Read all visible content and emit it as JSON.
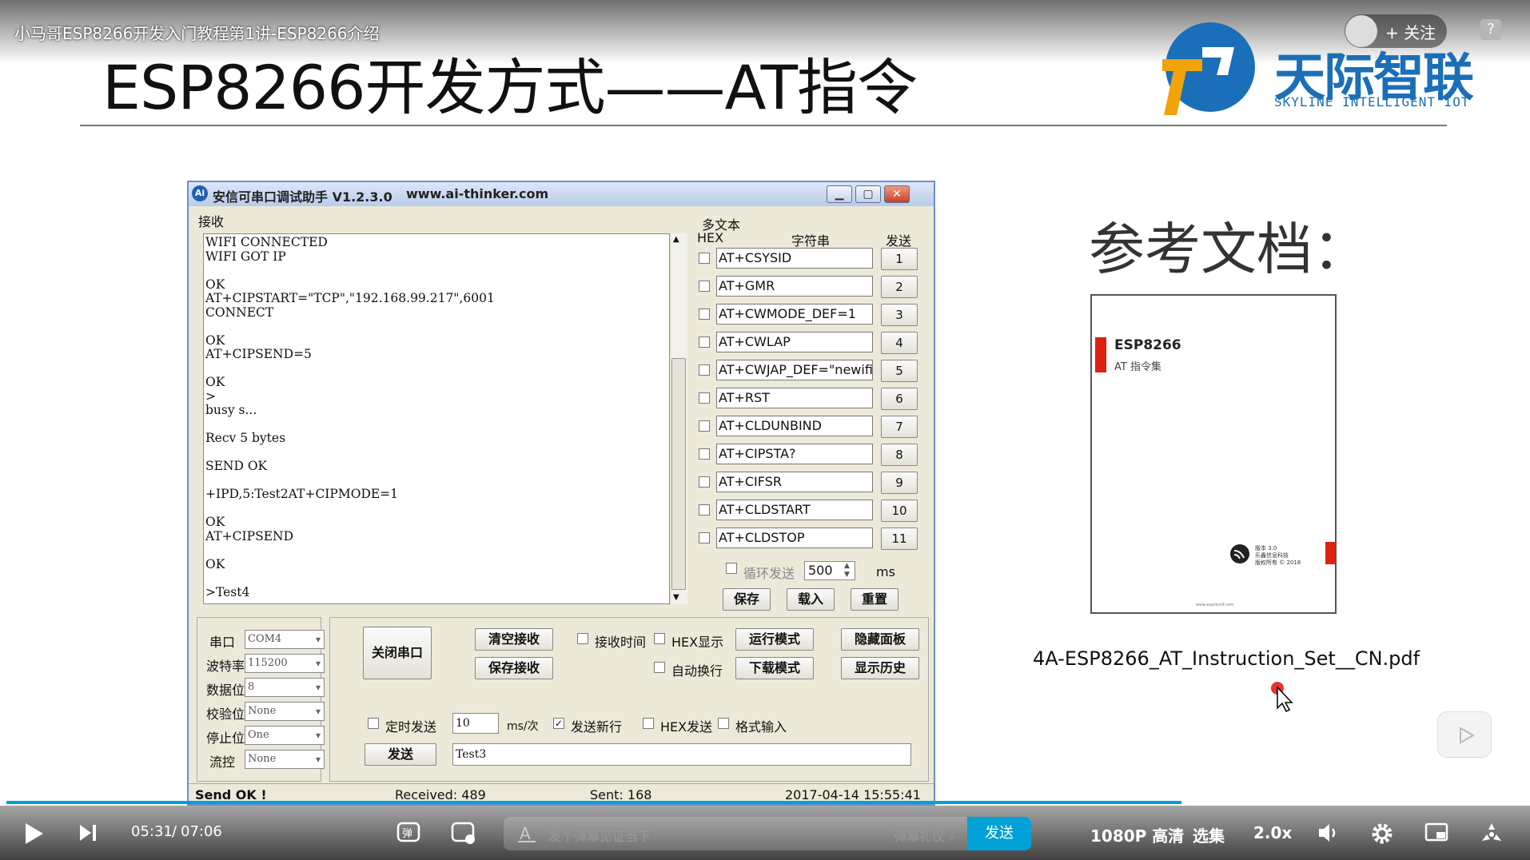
{
  "video": {
    "title": "小马哥ESP8266开发入门教程第1讲-ESP8266介绍",
    "follow_label": "+ 关注",
    "help": "?"
  },
  "slide": {
    "title": "ESP8266开发方式——AT指令",
    "logo_cn": "天际智联",
    "logo_en": "SKYLINE INTELLIGENT IOT",
    "ref_title": "参考文档：",
    "doc_file": "4A-ESP8266_AT_Instruction_Set__CN.pdf",
    "cover_title": "ESP8266",
    "cover_sub": "AT 指令集",
    "cover_brand": "版本 3.0\n乐鑫信息科技\n版权所有 © 2018",
    "cover_foot": "www.espressif.com"
  },
  "app": {
    "title": "安信可串口调试助手 V1.2.3.0",
    "url": "www.ai-thinker.com",
    "recv_label": "接收",
    "multi_label": "多文本",
    "hex_label": "HEX",
    "str_label": "字符串",
    "send_label": "发送",
    "recv_text": "WIFI CONNECTED\nWIFI GOT IP\n\nOK\nAT+CIPSTART=\"TCP\",\"192.168.99.217\",6001\nCONNECT\n\nOK\nAT+CIPSEND=5\n\nOK\n>\nbusy s...\n\nRecv 5 bytes\n\nSEND OK\n\n+IPD,5:Test2AT+CIPMODE=1\n\nOK\nAT+CIPSEND\n\nOK\n\n>Test4",
    "commands": [
      {
        "text": "AT+CSYSID",
        "n": "1"
      },
      {
        "text": "AT+GMR",
        "n": "2"
      },
      {
        "text": "AT+CWMODE_DEF=1",
        "n": "3"
      },
      {
        "text": "AT+CWLAP",
        "n": "4"
      },
      {
        "text": "AT+CWJAP_DEF=\"newifi_",
        "n": "5"
      },
      {
        "text": "AT+RST",
        "n": "6"
      },
      {
        "text": "AT+CLDUNBIND",
        "n": "7"
      },
      {
        "text": "AT+CIPSTA?",
        "n": "8"
      },
      {
        "text": "AT+CIFSR",
        "n": "9"
      },
      {
        "text": "AT+CLDSTART",
        "n": "10"
      },
      {
        "text": "AT+CLDSTOP",
        "n": "11"
      }
    ],
    "loop_label": "循环发送",
    "loop_value": "500",
    "ms": "ms",
    "save": "保存",
    "load": "载入",
    "reset": "重置",
    "port_label": "串口",
    "port": "COM4",
    "baud_label": "波特率",
    "baud": "115200",
    "data_label": "数据位",
    "data": "8",
    "parity_label": "校验位",
    "parity": "None",
    "stop_label": "停止位",
    "stop": "One",
    "flow_label": "流控",
    "flow": "None",
    "close_port": "关闭串口",
    "clear_recv": "清空接收",
    "save_recv": "保存接收",
    "recv_time": "接收时间",
    "hex_show": "HEX显示",
    "auto_wrap": "自动换行",
    "run_mode": "运行模式",
    "dl_mode": "下载模式",
    "hide_panel": "隐藏面板",
    "show_hist": "显示历史",
    "timed_send": "定时发送",
    "timed_value": "10",
    "ms_per": "ms/次",
    "send_newline": "发送新行",
    "hex_send": "HEX发送",
    "fmt_input": "格式输入",
    "send_btn": "发送",
    "send_text": "Test3",
    "status_left": "Send OK !",
    "received": "Received: 489",
    "sent": "Sent: 168",
    "datetime": "2017-04-14 15:55:41"
  },
  "player": {
    "time_current": "05:31",
    "time_sep": "/",
    "time_total": "07:06",
    "danmaku_placeholder": "发个弹幕见证当下",
    "danmaku_etiquette": "弹幕礼仪 ›",
    "danmaku_send": "发送",
    "quality": "1080P 高清",
    "episodes": "选集",
    "speed": "2.0x",
    "progress": 0.84
  }
}
